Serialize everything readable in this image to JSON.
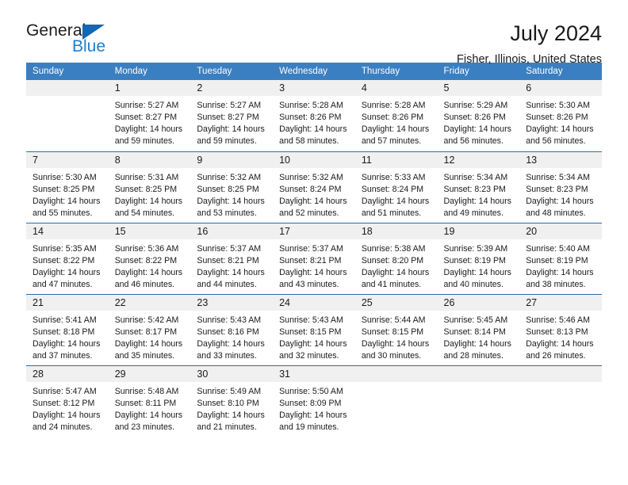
{
  "brand": {
    "name_part1": "General",
    "name_part2": "Blue",
    "triangle_color": "#1567b3",
    "blue_color": "#1f7fd1"
  },
  "header": {
    "title": "July 2024",
    "subtitle": "Fisher, Illinois, United States"
  },
  "theme": {
    "header_blue": "#3a7fc1",
    "row_divider_blue": "#2e6da4",
    "daynum_band": "#f0f0f0"
  },
  "weekday_headers": [
    "Sunday",
    "Monday",
    "Tuesday",
    "Wednesday",
    "Thursday",
    "Friday",
    "Saturday"
  ],
  "weeks": [
    [
      {
        "day": "",
        "sunrise": "",
        "sunset": "",
        "daylight": "",
        "blank": true
      },
      {
        "day": "1",
        "sunrise": "Sunrise: 5:27 AM",
        "sunset": "Sunset: 8:27 PM",
        "daylight": "Daylight: 14 hours and 59 minutes."
      },
      {
        "day": "2",
        "sunrise": "Sunrise: 5:27 AM",
        "sunset": "Sunset: 8:27 PM",
        "daylight": "Daylight: 14 hours and 59 minutes."
      },
      {
        "day": "3",
        "sunrise": "Sunrise: 5:28 AM",
        "sunset": "Sunset: 8:26 PM",
        "daylight": "Daylight: 14 hours and 58 minutes."
      },
      {
        "day": "4",
        "sunrise": "Sunrise: 5:28 AM",
        "sunset": "Sunset: 8:26 PM",
        "daylight": "Daylight: 14 hours and 57 minutes."
      },
      {
        "day": "5",
        "sunrise": "Sunrise: 5:29 AM",
        "sunset": "Sunset: 8:26 PM",
        "daylight": "Daylight: 14 hours and 56 minutes."
      },
      {
        "day": "6",
        "sunrise": "Sunrise: 5:30 AM",
        "sunset": "Sunset: 8:26 PM",
        "daylight": "Daylight: 14 hours and 56 minutes."
      }
    ],
    [
      {
        "day": "7",
        "sunrise": "Sunrise: 5:30 AM",
        "sunset": "Sunset: 8:25 PM",
        "daylight": "Daylight: 14 hours and 55 minutes."
      },
      {
        "day": "8",
        "sunrise": "Sunrise: 5:31 AM",
        "sunset": "Sunset: 8:25 PM",
        "daylight": "Daylight: 14 hours and 54 minutes."
      },
      {
        "day": "9",
        "sunrise": "Sunrise: 5:32 AM",
        "sunset": "Sunset: 8:25 PM",
        "daylight": "Daylight: 14 hours and 53 minutes."
      },
      {
        "day": "10",
        "sunrise": "Sunrise: 5:32 AM",
        "sunset": "Sunset: 8:24 PM",
        "daylight": "Daylight: 14 hours and 52 minutes."
      },
      {
        "day": "11",
        "sunrise": "Sunrise: 5:33 AM",
        "sunset": "Sunset: 8:24 PM",
        "daylight": "Daylight: 14 hours and 51 minutes."
      },
      {
        "day": "12",
        "sunrise": "Sunrise: 5:34 AM",
        "sunset": "Sunset: 8:23 PM",
        "daylight": "Daylight: 14 hours and 49 minutes."
      },
      {
        "day": "13",
        "sunrise": "Sunrise: 5:34 AM",
        "sunset": "Sunset: 8:23 PM",
        "daylight": "Daylight: 14 hours and 48 minutes."
      }
    ],
    [
      {
        "day": "14",
        "sunrise": "Sunrise: 5:35 AM",
        "sunset": "Sunset: 8:22 PM",
        "daylight": "Daylight: 14 hours and 47 minutes."
      },
      {
        "day": "15",
        "sunrise": "Sunrise: 5:36 AM",
        "sunset": "Sunset: 8:22 PM",
        "daylight": "Daylight: 14 hours and 46 minutes."
      },
      {
        "day": "16",
        "sunrise": "Sunrise: 5:37 AM",
        "sunset": "Sunset: 8:21 PM",
        "daylight": "Daylight: 14 hours and 44 minutes."
      },
      {
        "day": "17",
        "sunrise": "Sunrise: 5:37 AM",
        "sunset": "Sunset: 8:21 PM",
        "daylight": "Daylight: 14 hours and 43 minutes."
      },
      {
        "day": "18",
        "sunrise": "Sunrise: 5:38 AM",
        "sunset": "Sunset: 8:20 PM",
        "daylight": "Daylight: 14 hours and 41 minutes."
      },
      {
        "day": "19",
        "sunrise": "Sunrise: 5:39 AM",
        "sunset": "Sunset: 8:19 PM",
        "daylight": "Daylight: 14 hours and 40 minutes."
      },
      {
        "day": "20",
        "sunrise": "Sunrise: 5:40 AM",
        "sunset": "Sunset: 8:19 PM",
        "daylight": "Daylight: 14 hours and 38 minutes."
      }
    ],
    [
      {
        "day": "21",
        "sunrise": "Sunrise: 5:41 AM",
        "sunset": "Sunset: 8:18 PM",
        "daylight": "Daylight: 14 hours and 37 minutes."
      },
      {
        "day": "22",
        "sunrise": "Sunrise: 5:42 AM",
        "sunset": "Sunset: 8:17 PM",
        "daylight": "Daylight: 14 hours and 35 minutes."
      },
      {
        "day": "23",
        "sunrise": "Sunrise: 5:43 AM",
        "sunset": "Sunset: 8:16 PM",
        "daylight": "Daylight: 14 hours and 33 minutes."
      },
      {
        "day": "24",
        "sunrise": "Sunrise: 5:43 AM",
        "sunset": "Sunset: 8:15 PM",
        "daylight": "Daylight: 14 hours and 32 minutes."
      },
      {
        "day": "25",
        "sunrise": "Sunrise: 5:44 AM",
        "sunset": "Sunset: 8:15 PM",
        "daylight": "Daylight: 14 hours and 30 minutes."
      },
      {
        "day": "26",
        "sunrise": "Sunrise: 5:45 AM",
        "sunset": "Sunset: 8:14 PM",
        "daylight": "Daylight: 14 hours and 28 minutes."
      },
      {
        "day": "27",
        "sunrise": "Sunrise: 5:46 AM",
        "sunset": "Sunset: 8:13 PM",
        "daylight": "Daylight: 14 hours and 26 minutes."
      }
    ],
    [
      {
        "day": "28",
        "sunrise": "Sunrise: 5:47 AM",
        "sunset": "Sunset: 8:12 PM",
        "daylight": "Daylight: 14 hours and 24 minutes."
      },
      {
        "day": "29",
        "sunrise": "Sunrise: 5:48 AM",
        "sunset": "Sunset: 8:11 PM",
        "daylight": "Daylight: 14 hours and 23 minutes."
      },
      {
        "day": "30",
        "sunrise": "Sunrise: 5:49 AM",
        "sunset": "Sunset: 8:10 PM",
        "daylight": "Daylight: 14 hours and 21 minutes."
      },
      {
        "day": "31",
        "sunrise": "Sunrise: 5:50 AM",
        "sunset": "Sunset: 8:09 PM",
        "daylight": "Daylight: 14 hours and 19 minutes."
      },
      {
        "day": "",
        "sunrise": "",
        "sunset": "",
        "daylight": "",
        "blank": true
      },
      {
        "day": "",
        "sunrise": "",
        "sunset": "",
        "daylight": "",
        "blank": true
      },
      {
        "day": "",
        "sunrise": "",
        "sunset": "",
        "daylight": "",
        "blank": true
      }
    ]
  ]
}
